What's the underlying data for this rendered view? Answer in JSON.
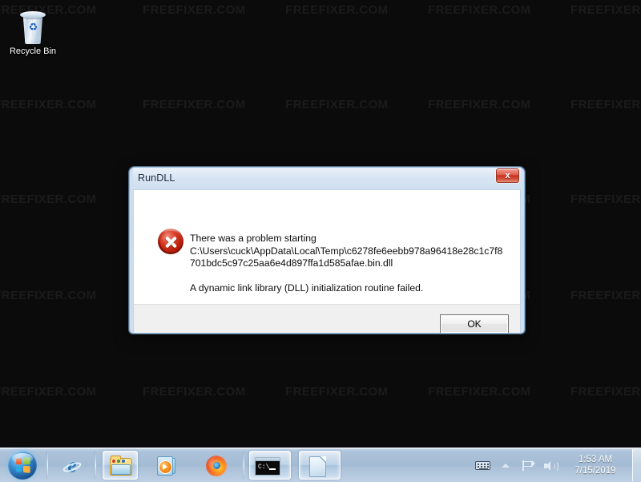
{
  "desktop": {
    "background_color": "#0b0b0b",
    "watermark_text": "FREEFIXER.COM",
    "icons": [
      {
        "name": "recycle-bin",
        "label": "Recycle Bin"
      }
    ]
  },
  "dialog": {
    "title": "RunDLL",
    "close_label": "x",
    "icon": "error-icon",
    "message_line_1": "There was a problem starting",
    "message_line_2": "C:\\Users\\cuck\\AppData\\Local\\Temp\\c6278fe6eebb978a96418e28c1c7f8",
    "message_line_3": "701bdc5c97c25aa6e4d897ffa1d585afae.bin.dll",
    "message_line_4": "A dynamic link library (DLL) initialization routine failed.",
    "ok_label": "OK"
  },
  "taskbar": {
    "start_label": "Start",
    "items": [
      {
        "name": "internet-explorer",
        "label": "Internet Explorer",
        "active": false
      },
      {
        "name": "file-explorer",
        "label": "Windows Explorer",
        "active": true
      },
      {
        "name": "windows-media-player",
        "label": "Windows Media Player",
        "active": false
      },
      {
        "name": "firefox",
        "label": "Mozilla Firefox",
        "active": false
      },
      {
        "name": "command-prompt",
        "label": "Command Prompt",
        "active": true
      },
      {
        "name": "document",
        "label": "Document",
        "active": true
      }
    ],
    "tray": {
      "icons": [
        {
          "name": "keyboard-icon",
          "label": "Keyboard layout"
        },
        {
          "name": "show-hidden-icons-icon",
          "label": "Show hidden icons"
        },
        {
          "name": "action-center-flag-icon",
          "label": "Action Center"
        },
        {
          "name": "volume-speaker-icon",
          "label": "Volume"
        }
      ],
      "clock_time": "1:53 AM",
      "clock_date": "7/15/2019"
    }
  }
}
